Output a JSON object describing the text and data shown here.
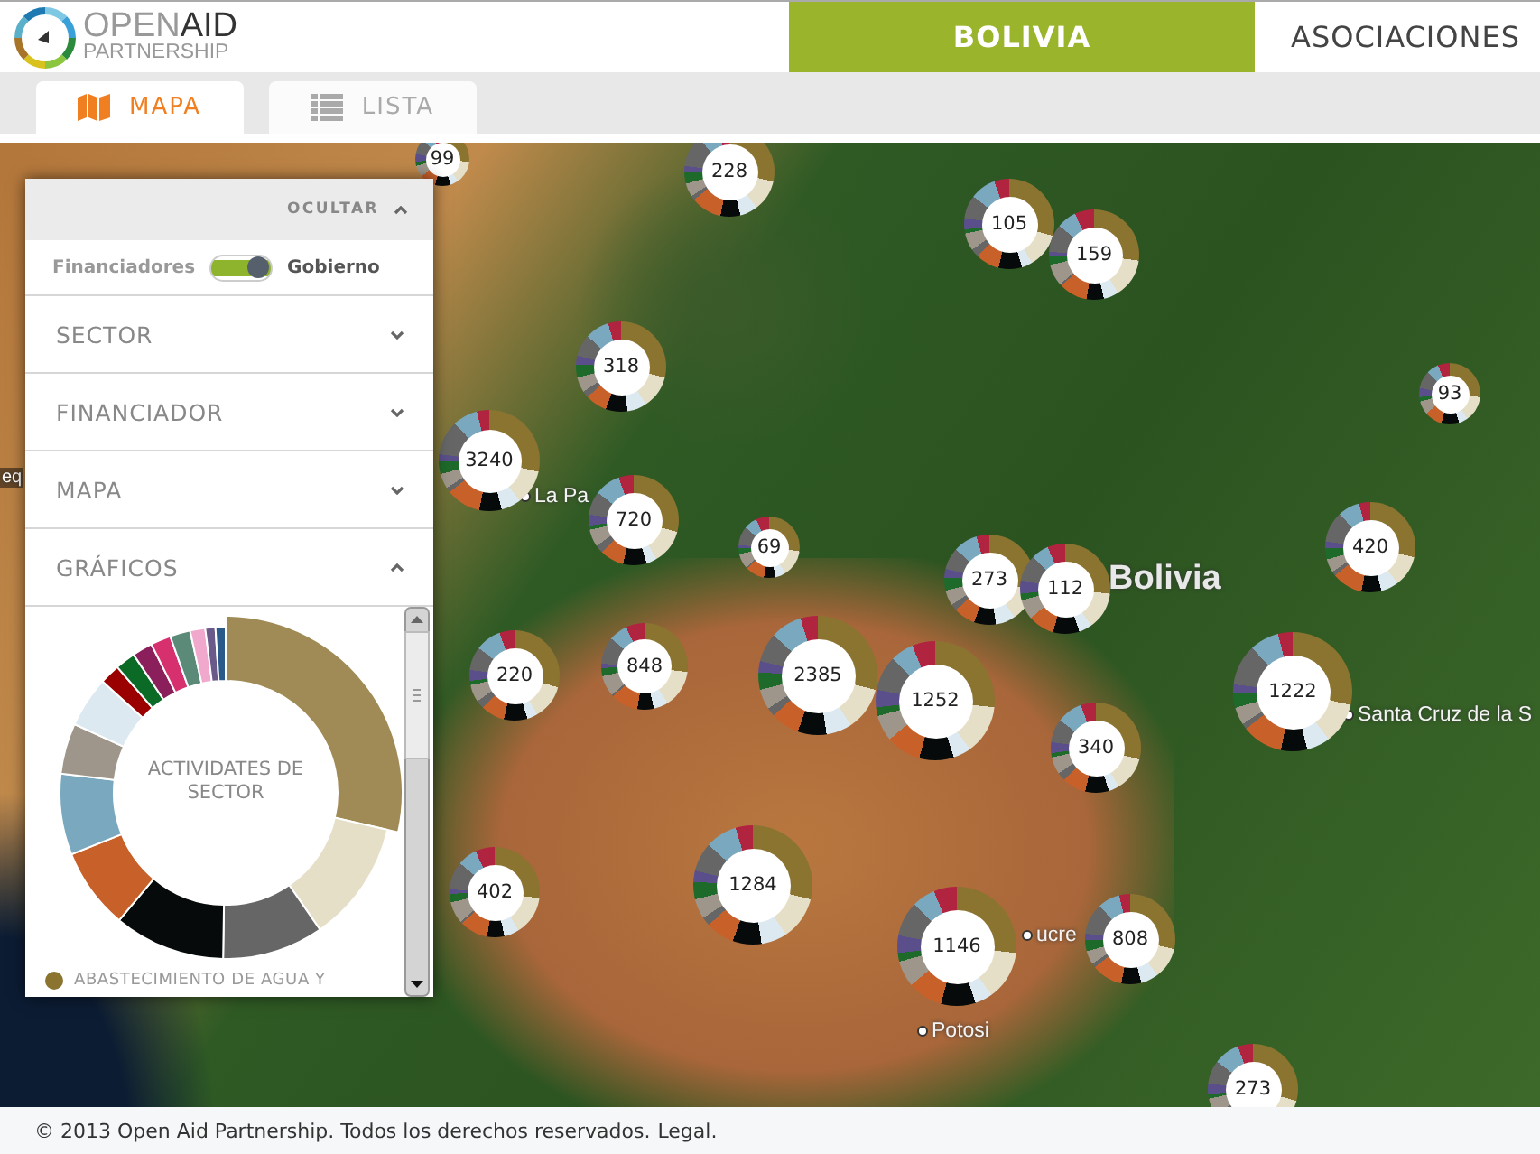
{
  "header": {
    "logo": {
      "line_1": "OPEN**AID**",
      "line_2": "PARTNERSHIP"
    },
    "nav": [
      {
        "label": "BOLIVIA",
        "selected": true
      },
      {
        "label": "ASOCIACIONES",
        "selected": false
      }
    ]
  },
  "view_tabs": [
    {
      "label": "MAPA",
      "selected": true
    },
    {
      "label": "LISTA",
      "selected": false
    }
  ],
  "sidebar": {
    "hide_button": "OCULTAR",
    "toggle": {
      "left_label": "Financiadores",
      "right_label": "Gobierno",
      "on": true
    },
    "sections": [
      {
        "label": "SECTOR",
        "expanded": false
      },
      {
        "label": "FINANCIADOR",
        "expanded": false
      },
      {
        "label": "MAPA",
        "expanded": false
      },
      {
        "label": "GRÁFICOS",
        "expanded": true
      }
    ],
    "chart": {
      "center_label": "ACTIVIDATES DE SECTOR",
      "legend": [
        {
          "label": "ABASTECIMIENTO DE AGUA Y",
          "color": "#8b7330"
        }
      ]
    }
  },
  "map": {
    "place_labels": [
      {
        "text": "eq",
        "kind": "edge"
      },
      {
        "text": "La Pa",
        "kind": "city"
      },
      {
        "text": "Bolivia",
        "kind": "country"
      },
      {
        "text": "Santa Cruz de la S",
        "kind": "city"
      },
      {
        "text": "ucre",
        "kind": "city"
      },
      {
        "text": "Potosi",
        "kind": "city"
      }
    ],
    "clusters": [
      {
        "count": "99"
      },
      {
        "count": "228"
      },
      {
        "count": "105"
      },
      {
        "count": "159"
      },
      {
        "count": "318"
      },
      {
        "count": "93"
      },
      {
        "count": "3240"
      },
      {
        "count": "720"
      },
      {
        "count": "69"
      },
      {
        "count": "273"
      },
      {
        "count": "112"
      },
      {
        "count": "420"
      },
      {
        "count": "220"
      },
      {
        "count": "848"
      },
      {
        "count": "2385"
      },
      {
        "count": "1252"
      },
      {
        "count": "1222"
      },
      {
        "count": "340"
      },
      {
        "count": "402"
      },
      {
        "count": "1284"
      },
      {
        "count": "1146"
      },
      {
        "count": "808"
      },
      {
        "count": "273"
      }
    ]
  },
  "footer": {
    "text": "© 2013 Open Aid Partnership. Todos los derechos reservados.",
    "link": "Legal."
  }
}
